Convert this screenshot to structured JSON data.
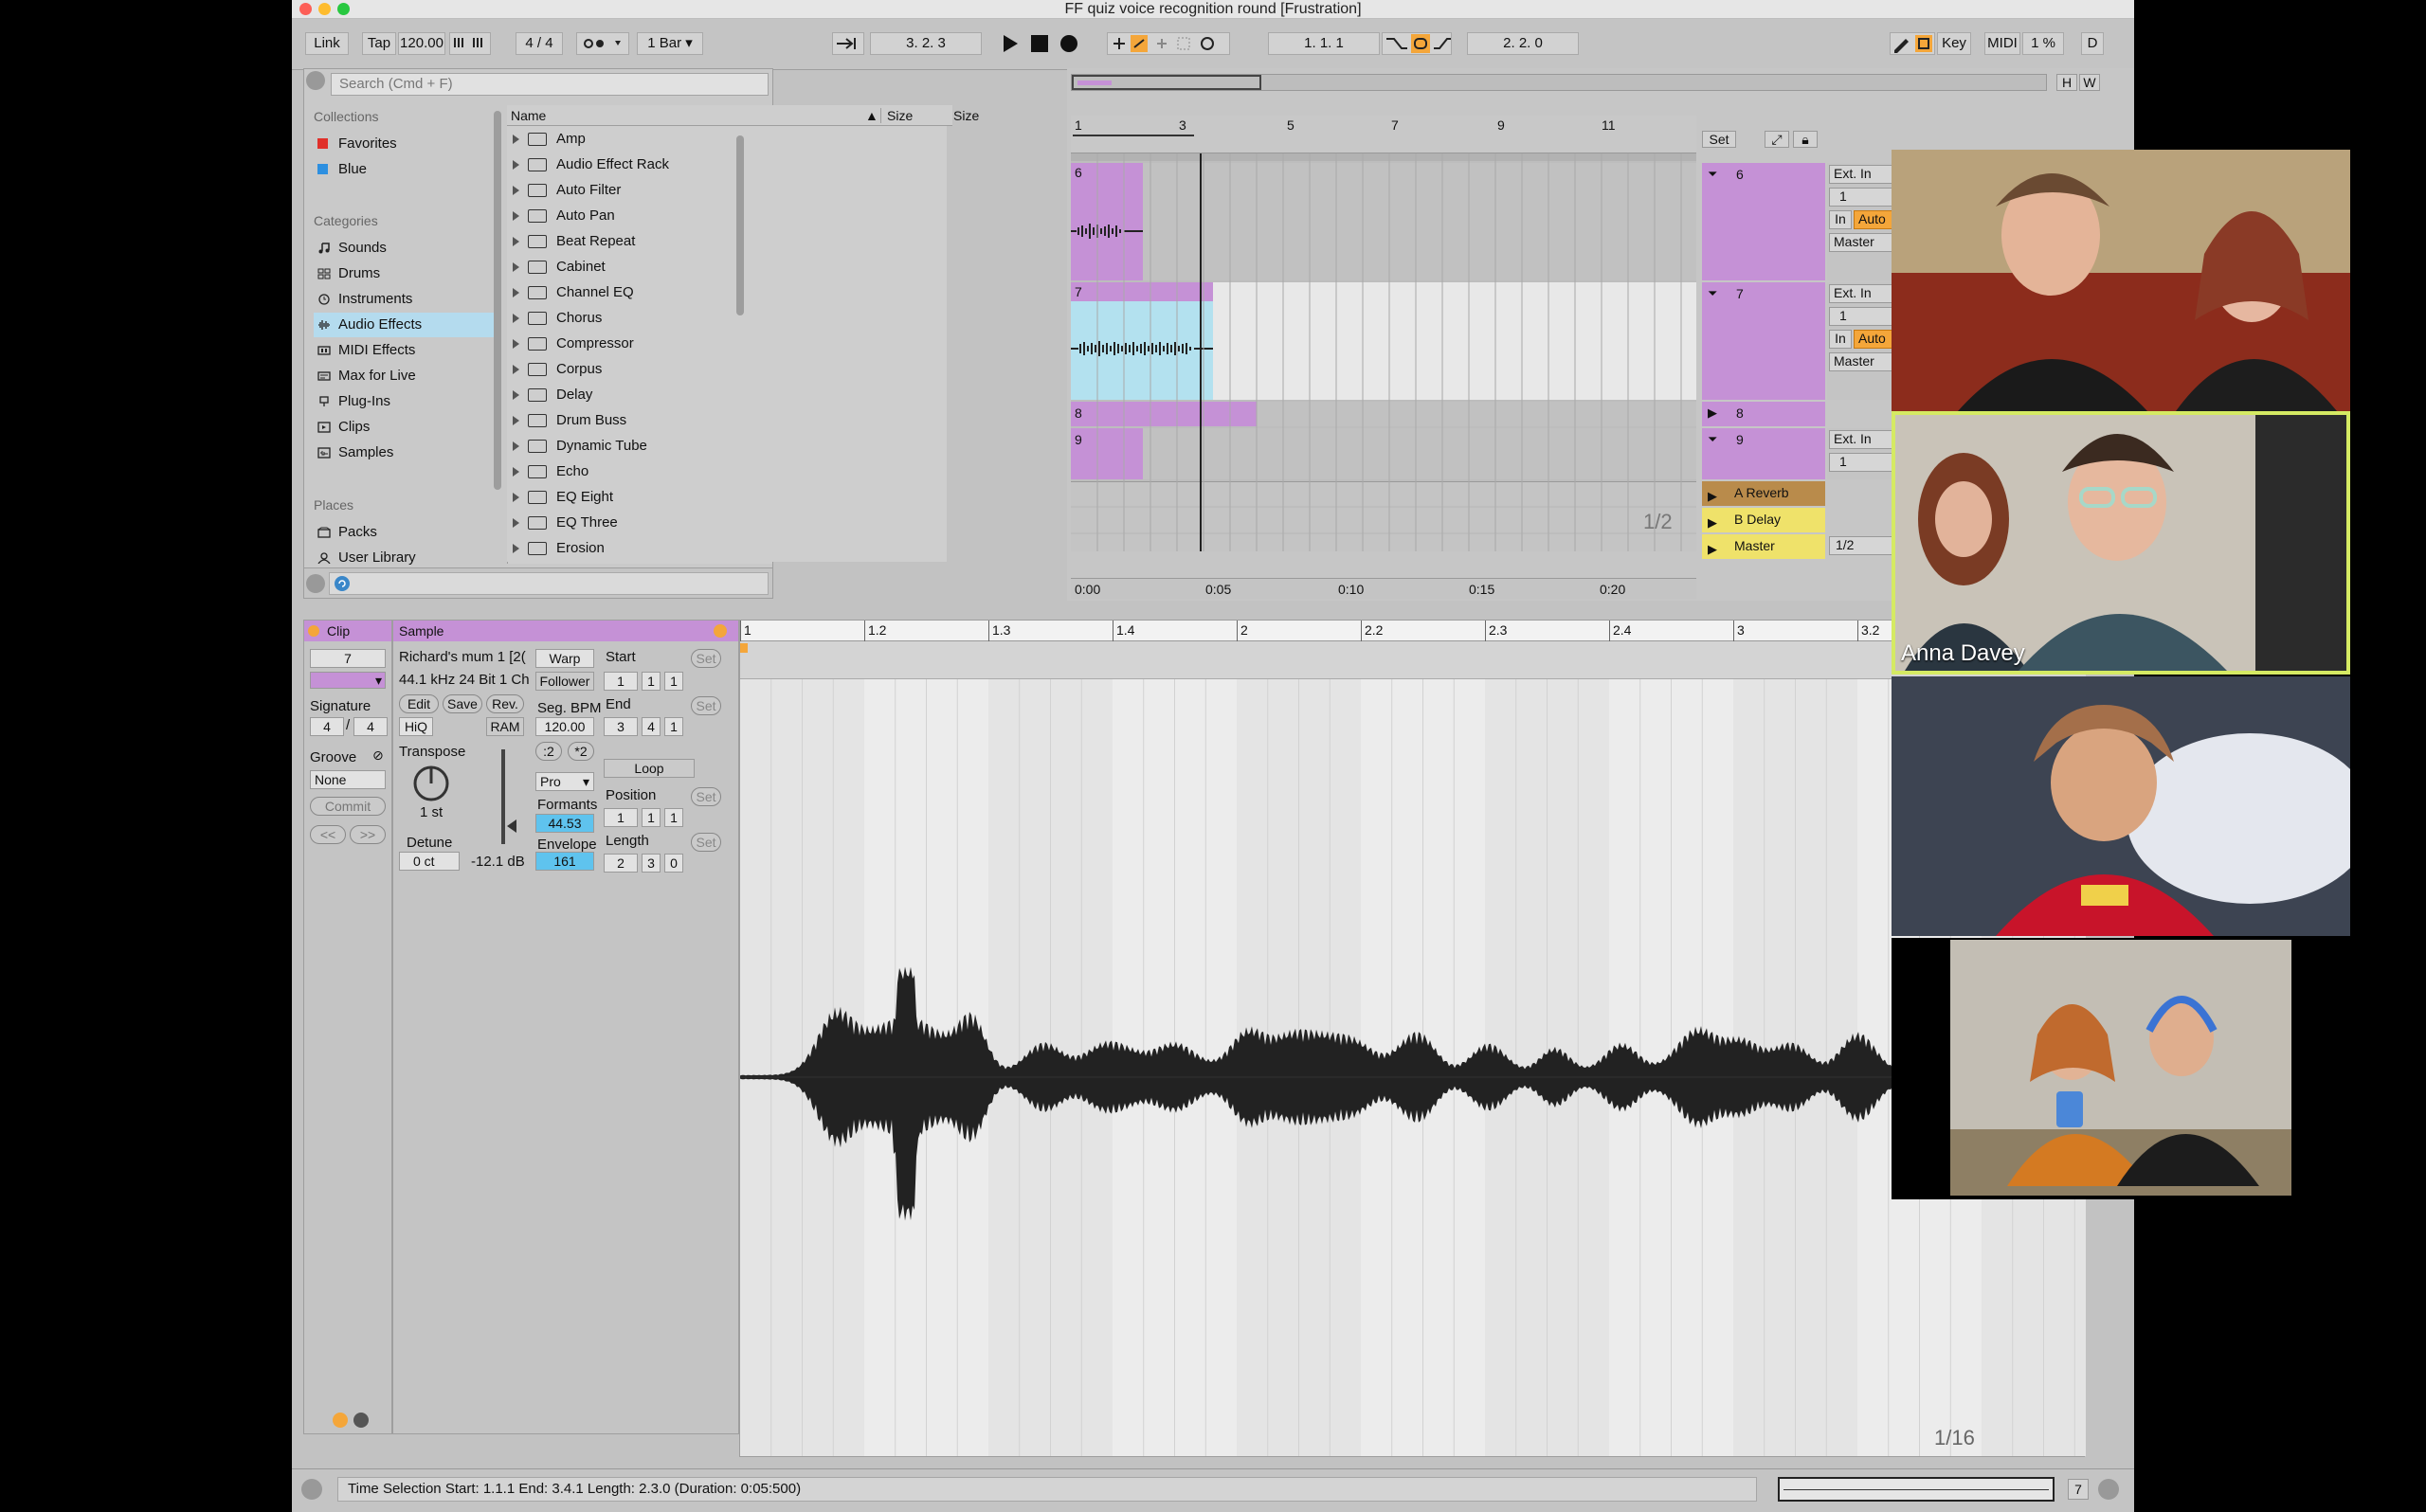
{
  "window": {
    "title": "FF quiz voice recognition round  [Frustration]"
  },
  "control_bar": {
    "link": "Link",
    "tap": "Tap",
    "tempo": "120.00",
    "signature_num": "4",
    "signature_den": "4",
    "quantize": "1 Bar",
    "arrangement_position": "3.   2.   3",
    "loop_start": "1.   1.   1",
    "loop_length": "2.   2.   0",
    "key": "Key",
    "midi": "MIDI",
    "cpu": "1 %",
    "d": "D"
  },
  "browser": {
    "search_placeholder": "Search (Cmd + F)",
    "collections_heading": "Collections",
    "collections": [
      {
        "label": "Favorites",
        "color": "#e0302a"
      },
      {
        "label": "Blue",
        "color": "#2d8fe0"
      }
    ],
    "categories_heading": "Categories",
    "categories": [
      {
        "label": "Sounds",
        "icon": "note-icon"
      },
      {
        "label": "Drums",
        "icon": "grid-icon"
      },
      {
        "label": "Instruments",
        "icon": "clock-icon"
      },
      {
        "label": "Audio Effects",
        "icon": "waveform-icon"
      },
      {
        "label": "MIDI Effects",
        "icon": "midi-icon"
      },
      {
        "label": "Max for Live",
        "icon": "max-icon"
      },
      {
        "label": "Plug-Ins",
        "icon": "plug-icon"
      },
      {
        "label": "Clips",
        "icon": "clip-icon"
      },
      {
        "label": "Samples",
        "icon": "samples-icon"
      }
    ],
    "selected_category": "Audio Effects",
    "places_heading": "Places",
    "places": [
      {
        "label": "Packs",
        "icon": "packs-icon"
      },
      {
        "label": "User Library",
        "icon": "user-icon"
      }
    ],
    "columns": {
      "name": "Name",
      "size": "Size"
    },
    "items": [
      "Amp",
      "Audio Effect Rack",
      "Auto Filter",
      "Auto Pan",
      "Beat Repeat",
      "Cabinet",
      "Channel EQ",
      "Chorus",
      "Compressor",
      "Corpus",
      "Delay",
      "Drum Buss",
      "Dynamic Tube",
      "Echo",
      "EQ Eight",
      "EQ Three",
      "Erosion"
    ]
  },
  "arrangement": {
    "bar_markers": [
      "1",
      "3",
      "5",
      "7",
      "9",
      "11"
    ],
    "time_markers": [
      "0:00",
      "0:05",
      "0:10",
      "0:15",
      "0:20"
    ],
    "zoom": "1/2",
    "set_label": "Set",
    "h_label": "H",
    "w_label": "W",
    "tracks": [
      {
        "name": "6",
        "input": "Ext. In",
        "channel": "1",
        "monitor_in": "In",
        "monitor_auto": "Auto",
        "output": "Master"
      },
      {
        "name": "7",
        "input": "Ext. In",
        "channel": "1",
        "monitor_in": "In",
        "monitor_auto": "Auto",
        "output": "Master"
      },
      {
        "name": "8"
      },
      {
        "name": "9",
        "input": "Ext. In",
        "channel": "1"
      }
    ],
    "returns": [
      "A Reverb",
      "B Delay",
      "Master"
    ],
    "master_ratio": "1/2"
  },
  "clip": {
    "clip_label": "Clip",
    "clip_number": "7",
    "signature_label": "Signature",
    "sig_num": "4",
    "sig_den": "4",
    "groove_label": "Groove",
    "groove_value": "None",
    "commit": "Commit",
    "prev": "<<",
    "next": ">>"
  },
  "sample": {
    "sample_label": "Sample",
    "file_name": "Richard's mum 1 [2(",
    "file_info": "44.1 kHz 24 Bit 1 Ch",
    "edit": "Edit",
    "save": "Save",
    "rev": "Rev.",
    "hiq": "HiQ",
    "ram": "RAM",
    "warp": "Warp",
    "follower": "Follower",
    "seg_bpm_label": "Seg. BPM",
    "seg_bpm": "120.00",
    "half": ":2",
    "double": "*2",
    "mode": "Pro",
    "formants_label": "Formants",
    "formants": "44.53",
    "envelope_label": "Envelope",
    "envelope": "161",
    "transpose_label": "Transpose",
    "transpose": "1 st",
    "detune_label": "Detune",
    "detune": "0 ct",
    "gain": "-12.1 dB",
    "start_label": "Start",
    "start": [
      "1",
      "1",
      "1"
    ],
    "end_label": "End",
    "end": [
      "3",
      "4",
      "1"
    ],
    "loop": "Loop",
    "position_label": "Position",
    "position": [
      "1",
      "1",
      "1"
    ],
    "length_label": "Length",
    "length": [
      "2",
      "3",
      "0"
    ],
    "set": "Set"
  },
  "sample_editor": {
    "ruler": [
      "1",
      "1.2",
      "1.3",
      "1.4",
      "2",
      "2.2",
      "2.3",
      "2.4",
      "3",
      "3.2"
    ],
    "zoom": "1/16"
  },
  "status_bar": {
    "text": "Time Selection   Start: 1.1.1   End: 3.4.1   Length: 2.3.0  (Duration: 0:05:500)",
    "track_number": "7"
  },
  "video_call": {
    "active_speaker": "Anna Davey"
  }
}
